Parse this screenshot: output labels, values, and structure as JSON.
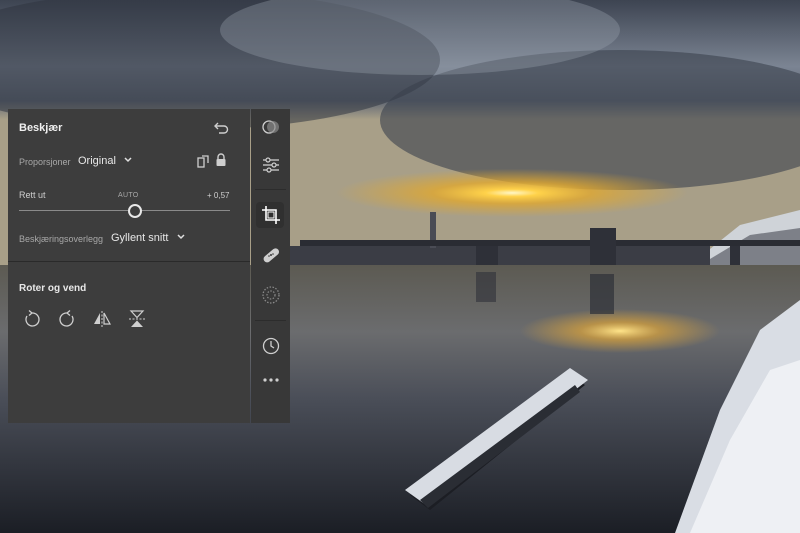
{
  "panel": {
    "title": "Beskjær",
    "aspect": {
      "label": "Proporsjoner",
      "value": "Original"
    },
    "straighten": {
      "label": "Rett ut",
      "auto_label": "AUTO",
      "value": "+ 0,57",
      "level": 0.55
    },
    "overlay": {
      "label": "Beskjæringsoverlegg",
      "value": "Gyllent snitt"
    },
    "rotate_section": {
      "title": "Roter og vend"
    }
  },
  "icons": {
    "reset": "reset-icon",
    "aspect_toggle": "swap-orientation-icon",
    "lock": "lock-icon",
    "rotate_left": "rotate-left-icon",
    "rotate_right": "rotate-right-icon",
    "flip_h": "flip-horizontal-icon",
    "flip_v": "flip-vertical-icon"
  },
  "rail": [
    "presets-icon",
    "adjust-icon",
    "crop-icon",
    "healing-icon",
    "masking-icon",
    "history-icon",
    "more-icon"
  ],
  "colors": {
    "accent": "#ffffff",
    "panel_bg": "#3d3d3d"
  }
}
